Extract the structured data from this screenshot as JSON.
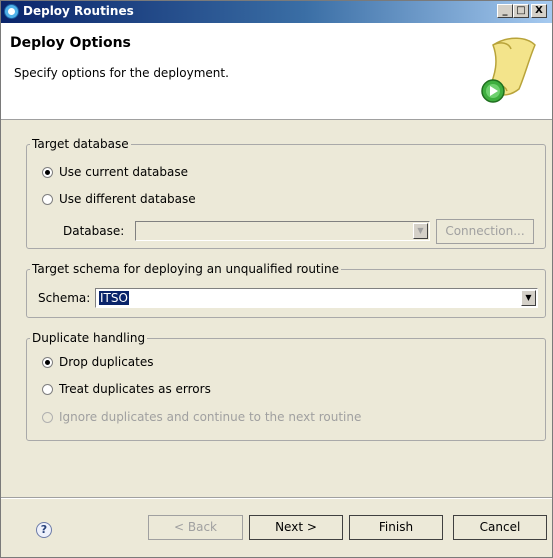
{
  "window": {
    "title": "Deploy Routines",
    "controls": {
      "minimize": "_",
      "maximize": "□",
      "close": "X"
    }
  },
  "header": {
    "title": "Deploy Options",
    "description": "Specify options for the deployment."
  },
  "target_database": {
    "legend": "Target database",
    "use_current": "Use current database",
    "use_different": "Use different database",
    "database_label": "Database:",
    "database_value": "",
    "connection_button": "Connection..."
  },
  "target_schema": {
    "legend": "Target schema for deploying an unqualified routine",
    "schema_label": "Schema:",
    "schema_value": "ITSO"
  },
  "duplicate_handling": {
    "legend": "Duplicate handling",
    "drop": "Drop duplicates",
    "treat_errors": "Treat duplicates as errors",
    "ignore": "Ignore duplicates and continue to the next routine"
  },
  "footer": {
    "help": "?",
    "back": "< Back",
    "next": "Next >",
    "finish": "Finish",
    "cancel": "Cancel"
  }
}
